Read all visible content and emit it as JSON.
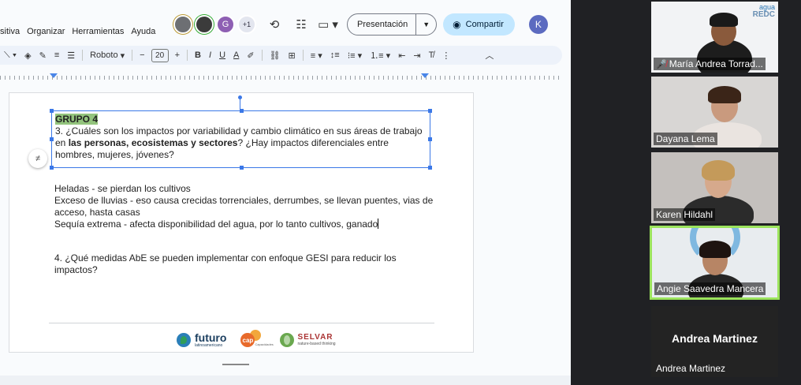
{
  "menu": [
    "sitiva",
    "Organizar",
    "Herramientas",
    "Ayuda"
  ],
  "collaborators": {
    "initial_g": "G",
    "more": "+1",
    "user_initial": "K"
  },
  "buttons": {
    "present": "Presentación",
    "share": "Compartir"
  },
  "toolbar": {
    "font": "Roboto",
    "font_size": "20"
  },
  "textbox": {
    "group": "GRUPO 4",
    "q3_a": "3. ¿Cuáles son los impactos por variabilidad y cambio climático en sus áreas de trabajo en ",
    "q3_bold": "las personas, ecosistemas y sectores",
    "q3_b": "? ¿Hay impactos diferenciales entre hombres, mujeres, jóvenes?"
  },
  "answers": [
    "Heladas - se pierdan los cultivos",
    "Exceso de lluvias - eso causa crecidas torrenciales, derrumbes, se llevan puentes, vias de acceso, hasta casas",
    "Sequía extrema - afecta disponibilidad del agua, por lo tanto cultivos, ganado"
  ],
  "question4": "4. ¿Qué medidas AbE se pueden implementar con enfoque GESI para reducir los impactos?",
  "logos": {
    "futuro": "futuro",
    "futuro_sub": "latinoamericano",
    "cap_mark": "cap",
    "cap_sub": "Capacidades",
    "selvar": "SELVAR",
    "selvar_sub": "nature-based thinking"
  },
  "participants": [
    {
      "name": "María Andrea Torrad...",
      "muted": true,
      "logo_top": "agua",
      "logo_bottom": "REDC"
    },
    {
      "name": "Dayana Lema"
    },
    {
      "name": "Karen Hildahl"
    },
    {
      "name": "Angie Saavedra Mancera",
      "active": true
    },
    {
      "name": "Andrea Martinez",
      "camera_off_label": "Andrea Martinez"
    }
  ],
  "colors": {
    "active_speaker": "#9be35c",
    "share_button": "#c2e7ff",
    "group_highlight": "#93c47d",
    "selection": "#3b78e7"
  }
}
